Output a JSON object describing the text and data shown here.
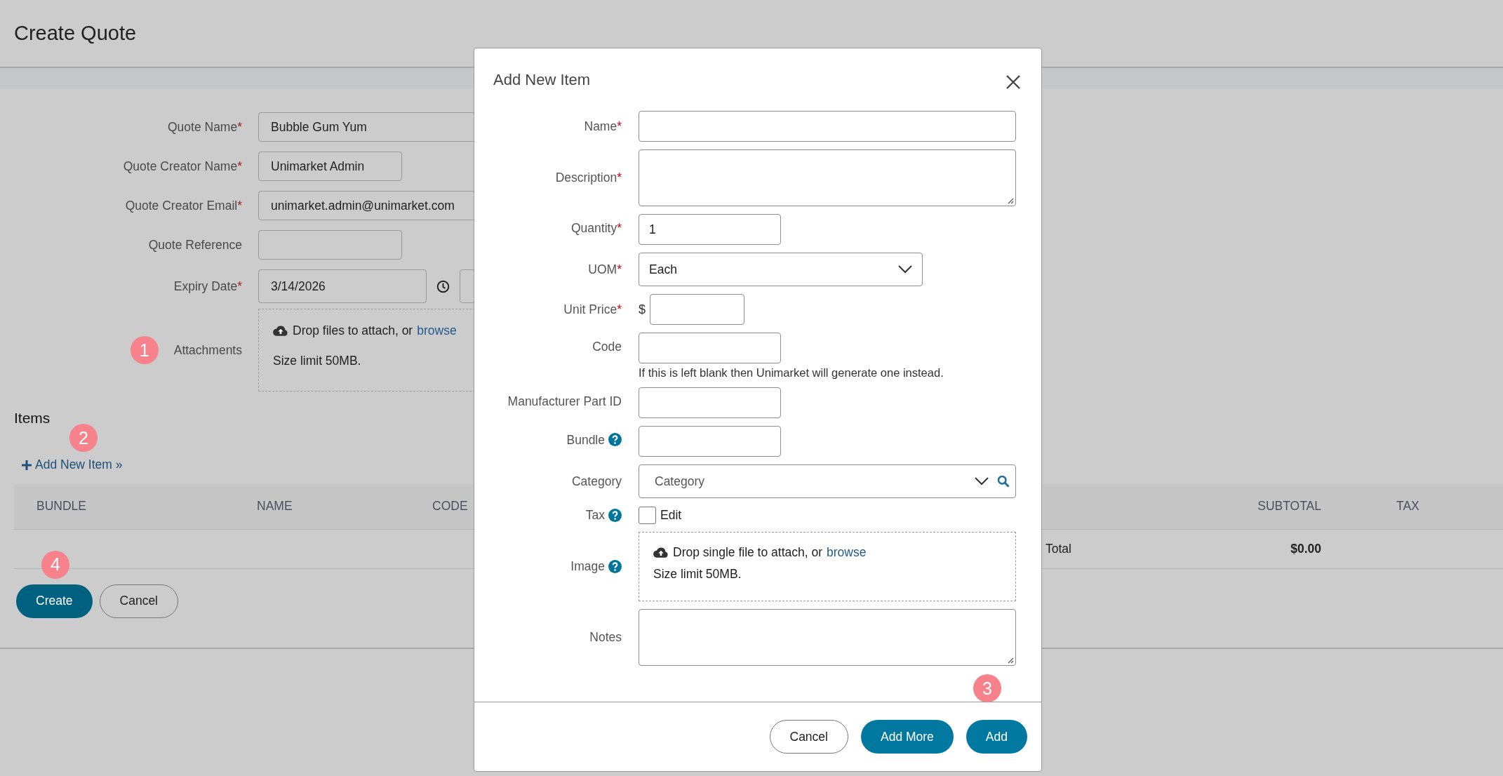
{
  "page": {
    "title": "Create Quote"
  },
  "form": {
    "fields": [
      {
        "label": "Quote Name",
        "required_mark": "*",
        "value": "Bubble Gum Yum",
        "kind": "wide"
      },
      {
        "label": "Quote Creator Name",
        "required_mark": "*",
        "value": "Unimarket Admin",
        "kind": "short"
      },
      {
        "label": "Quote Creator Email",
        "required_mark": "*",
        "value": "unimarket.admin@unimarket.com",
        "kind": "wide"
      },
      {
        "label": "Quote Reference",
        "kind": "short"
      },
      {
        "label": "Expiry Date",
        "required_mark": "*",
        "value": "3/14/2026",
        "kind": "date"
      }
    ],
    "attachments": {
      "label": "Attachments",
      "marker": "1",
      "prompt": "Drop files to attach, or",
      "link": "browse",
      "limit": "Size limit 50MB."
    }
  },
  "items": {
    "heading": "Items",
    "marker": "2",
    "add_link": "Add New Item »",
    "table": {
      "columns": [
        "BUNDLE",
        "NAME",
        "CODE",
        "SUBTOTAL",
        "TAX"
      ],
      "total_label": "Total",
      "subtotal": "$0.00"
    }
  },
  "actions": {
    "marker": "4",
    "buttons": [
      {
        "label": "Create",
        "kind": "primary"
      },
      {
        "label": "Cancel",
        "kind": "secondary"
      }
    ]
  },
  "modal": {
    "title": "Add New Item",
    "fields": [
      {
        "label": "Name",
        "required_mark": "*",
        "help": false,
        "kind": "text"
      },
      {
        "label": "Description",
        "required_mark": "*",
        "help": false,
        "kind": "textarea"
      },
      {
        "label": "Quantity",
        "required_mark": "*",
        "help": false,
        "kind": "short",
        "value": "1"
      },
      {
        "label": "UOM",
        "required_mark": "*",
        "help": false,
        "kind": "select",
        "value": "Each"
      },
      {
        "label": "Unit Price",
        "required_mark": "*",
        "help": false,
        "kind": "price",
        "prefix": "$"
      },
      {
        "label": "Code",
        "help": false,
        "kind": "short",
        "hint": "If this is left blank then Unimarket will generate one instead."
      },
      {
        "label": "Manufacturer Part ID",
        "help": false,
        "kind": "short"
      },
      {
        "label": "Bundle",
        "help": true,
        "kind": "short"
      },
      {
        "label": "Category",
        "help": false,
        "kind": "search",
        "placeholder": "Category"
      },
      {
        "label": "Tax",
        "help": true,
        "kind": "checkbox",
        "option": "Edit",
        "checked": false
      },
      {
        "label": "Image",
        "help": true,
        "kind": "dropzone",
        "prompt": "Drop single file to attach, or",
        "link": "browse",
        "limit": "Size limit 50MB."
      },
      {
        "label": "Notes",
        "help": false,
        "kind": "textarea"
      }
    ],
    "marker": "3",
    "buttons": [
      {
        "label": "Cancel",
        "kind": "secondary"
      },
      {
        "label": "Add More",
        "kind": "primary"
      },
      {
        "label": "Add",
        "kind": "primary"
      }
    ]
  }
}
